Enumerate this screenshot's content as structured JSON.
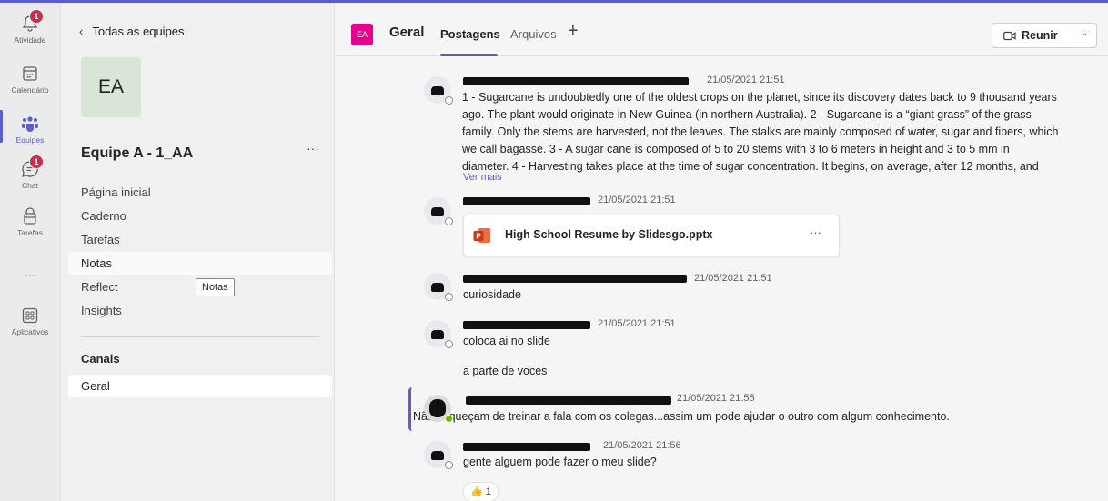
{
  "rail": {
    "items": [
      {
        "label": "Atividade",
        "icon": "bell-icon",
        "badge": "1"
      },
      {
        "label": "Calendário",
        "icon": "calendar-icon"
      },
      {
        "label": "Equipes",
        "icon": "teams-icon"
      },
      {
        "label": "Chat",
        "icon": "chat-icon",
        "badge": "1"
      },
      {
        "label": "Tarefas",
        "icon": "tasks-icon"
      },
      {
        "label": "...",
        "icon": "more-icon"
      },
      {
        "label": "Aplicativos",
        "icon": "apps-icon"
      }
    ]
  },
  "team_panel": {
    "back_label": "Todas as equipes",
    "avatar_initials": "EA",
    "team_name": "Equipe A - 1_AA",
    "more": "···",
    "nav": [
      "Página inicial",
      "Caderno",
      "Tarefas",
      "Notas",
      "Reflect",
      "Insights"
    ],
    "tooltip": "Notas",
    "channels_heading": "Canais",
    "channels": [
      "Geral"
    ]
  },
  "header": {
    "channel_avatar": "EA",
    "channel_name": "Geral",
    "tabs": [
      "Postagens",
      "Arquivos"
    ],
    "add_tab": "+",
    "meet_label": "Reunir",
    "meet_dropdown": "⌄"
  },
  "messages": [
    {
      "time": "21/05/2021 21:51",
      "lines": [
        "1 - Sugarcane is undoubtedly one of the oldest crops on the planet, since its discovery dates back to 9 thousand years",
        "ago. The plant would originate in New Guinea (in northern Australia). 2 - Sugarcane is a “giant grass” of the grass",
        "family. Only the stems are harvested, not the leaves. The stalks are mainly composed of water, sugar and fibers, which",
        "we call bagasse. 3 - A sugar cane is composed of 5 to 20 stems with 3 to 6 meters in height and 3 to 5 mm in",
        "diameter. 4 - Harvesting takes place at the time of sugar concentration. It begins, on average, after 12 months, and"
      ],
      "see_more": "Ver mais"
    },
    {
      "time": "21/05/2021 21:51",
      "file": "High School Resume by Slidesgo.pptx",
      "file_more": "···"
    },
    {
      "time": "21/05/2021 21:51",
      "lines": [
        "curiosidade"
      ]
    },
    {
      "time": "21/05/2021 21:51",
      "lines": [
        "coloca ai no slide",
        "a parte de voces"
      ]
    },
    {
      "time": "21/05/2021 21:55",
      "lines": [
        "Não esqueçam de treinar a fala com os colegas...assim um pode ajudar o outro com algum conhecimento."
      ]
    },
    {
      "time": "21/05/2021 21:56",
      "lines": [
        "gente alguem pode fazer o meu slide?"
      ],
      "reaction": {
        "emoji": "👍",
        "count": "1"
      }
    }
  ],
  "colors": {
    "accent": "#5b5fc7",
    "badge": "#c4314b",
    "channel_avatar": "#e3008c",
    "powerpoint": "#c43e1c"
  }
}
